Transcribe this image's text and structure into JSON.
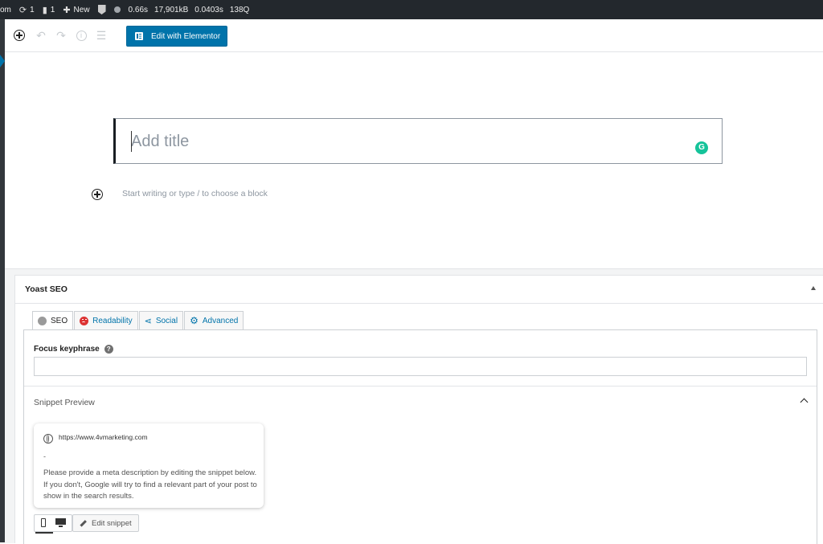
{
  "admin_bar": {
    "site_fragment": "om",
    "updates_count": "1",
    "comments_count": "1",
    "new_label": "New",
    "perf_time": "0.66s",
    "perf_memory": "17,901kB",
    "perf_query_time": "0.0403s",
    "perf_queries": "138Q"
  },
  "toolbar": {
    "elementor_label": "Edit with Elementor"
  },
  "editor": {
    "title_placeholder": "Add title",
    "block_appender": "Start writing or type / to choose a block",
    "grammarly_letter": "G"
  },
  "yoast": {
    "panel_title": "Yoast SEO",
    "tabs": [
      {
        "label": "SEO"
      },
      {
        "label": "Readability"
      },
      {
        "label": "Social"
      },
      {
        "label": "Advanced"
      }
    ],
    "focus_keyphrase_label": "Focus keyphrase",
    "focus_keyphrase_value": "",
    "snippet_preview_title": "Snippet Preview",
    "snippet": {
      "url": "https://www.4vmarketing.com",
      "title": "-",
      "description": "Please provide a meta description by editing the snippet below. If you don't, Google will try to find a relevant part of your post to show in the search results."
    },
    "edit_snippet_label": "Edit snippet"
  },
  "colors": {
    "accent": "#0073aa",
    "admin_bar_bg": "#23282d",
    "readability_status": "#dc3232",
    "grammarly": "#15c39a"
  }
}
